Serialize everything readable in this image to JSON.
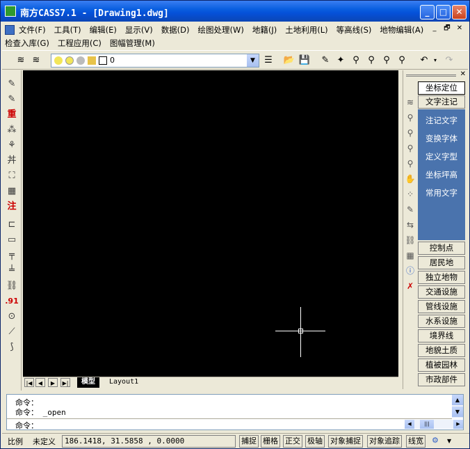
{
  "window": {
    "title": "南方CASS7.1 - [Drawing1.dwg]",
    "controls": {
      "minimize": "_",
      "maximize": "□",
      "close": "✕"
    }
  },
  "menu": {
    "row1": [
      "文件(F)",
      "工具(T)",
      "编辑(E)",
      "显示(V)",
      "数据(D)",
      "绘图处理(W)",
      "地籍(J)",
      "土地利用(L)",
      "等高线(S)",
      "地物编辑(A)"
    ],
    "row2": [
      "检查入库(G)",
      "工程应用(C)",
      "图幅管理(M)"
    ],
    "mdi": {
      "minimize": "_",
      "restore": "🗗",
      "close": "✕"
    }
  },
  "toolbar": {
    "layer_value": "0"
  },
  "left_tools": [
    "✎",
    "✎",
    "重",
    "⁂",
    "⚘",
    "丼",
    "⛶",
    "▦",
    "注",
    "⊏",
    "▭",
    "╤",
    "╧",
    "⛓",
    ".91",
    "⊙",
    "⟋",
    "⟆"
  ],
  "canvas": {
    "background": "#000000"
  },
  "tabs": {
    "model": "模型",
    "layout": "Layout1"
  },
  "right_panel": {
    "top_buttons": [
      "坐标定位",
      "文字注记"
    ],
    "list": [
      "注记文字",
      "变换字体",
      "定义字型",
      "坐标坪高",
      "常用文字"
    ],
    "bottom_buttons": [
      "控制点",
      "居民地",
      "独立地物",
      "交通设施",
      "管线设施",
      "水系设施",
      "境界线",
      "地貌土质",
      "植被园林",
      "市政部件"
    ],
    "accent": "#4a73ad"
  },
  "command": {
    "lines": [
      "命令：",
      "命令： _open",
      "命令："
    ]
  },
  "status": {
    "scale_label": "比例",
    "scale_value": "未定义",
    "coords": "186.1418,  31.5858 ,  0.0000",
    "toggles": [
      "捕捉",
      "栅格",
      "正交",
      "极轴",
      "对象捕捉",
      "对象追踪",
      "线宽"
    ]
  }
}
